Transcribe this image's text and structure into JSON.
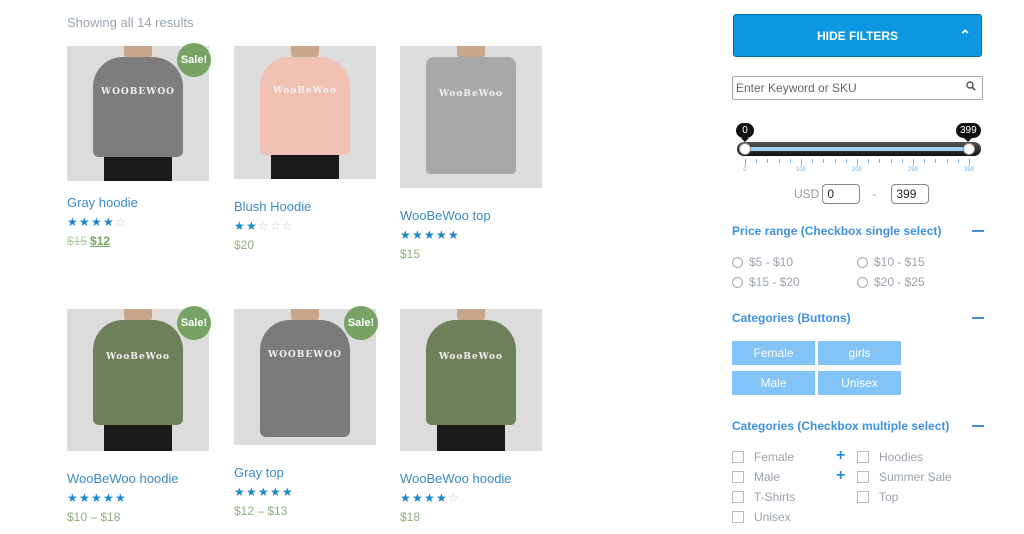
{
  "results_count": "Showing all 14 results",
  "products": [
    {
      "title": "Gray hoodie",
      "rating": 4,
      "price_old": "$15",
      "price": "$12",
      "sale": true,
      "sale_label": "Sale!",
      "color": "#7d7d7d",
      "logo": "WOOBEWOO"
    },
    {
      "title": "Blush Hoodie",
      "rating": 2,
      "price": "$20",
      "sale": false,
      "color": "#f1c1b3",
      "logo": "WooBeWoo"
    },
    {
      "title": "WooBeWoo top",
      "rating": 5,
      "price": "$15",
      "sale": false,
      "color": "#a8a8a8",
      "logo": "WooBeWoo"
    },
    {
      "title": "WooBeWoo hoodie",
      "rating": 5,
      "price": "$10 – $18",
      "sale": true,
      "sale_label": "Sale!",
      "color": "#6f7f59",
      "logo": "WooBeWoo"
    },
    {
      "title": "Gray top",
      "rating": 5,
      "price": "$12 – $13",
      "sale": true,
      "sale_label": "Sale!",
      "color": "#7b7b7b",
      "logo": "WOOBEWOO"
    },
    {
      "title": "WooBeWoo hoodie",
      "rating": 4,
      "price": "$18",
      "sale": false,
      "color": "#6f7f59",
      "logo": "WooBeWoo"
    }
  ],
  "sidebar": {
    "hide_filters_label": "HIDE FILTERS",
    "search_placeholder": "Enter Keyword or SKU",
    "slider": {
      "min": 0,
      "max": 399,
      "value_min": 0,
      "value_max": 399,
      "tip_min": "0",
      "tip_max": "399",
      "tick_labels": [
        "0",
        "100",
        "200",
        "299",
        "399"
      ]
    },
    "currency_label": "USD",
    "price_from": "0",
    "price_to": "399",
    "price_range_title": "Price range (Checkbox single select)",
    "price_ranges": [
      "$5 - $10",
      "$10 - $15",
      "$15 - $20",
      "$20 - $25"
    ],
    "categories_buttons_title": "Categories (Buttons)",
    "category_buttons": [
      "Female",
      "girls",
      "Male",
      "Unisex"
    ],
    "categories_checkbox_title": "Categories (Checkbox multiple select)",
    "category_checkboxes_left": [
      "Female",
      "Male",
      "T-Shirts",
      "Unisex"
    ],
    "category_checkboxes_right": [
      "Hoodies",
      "Summer Sale",
      "Top"
    ]
  }
}
